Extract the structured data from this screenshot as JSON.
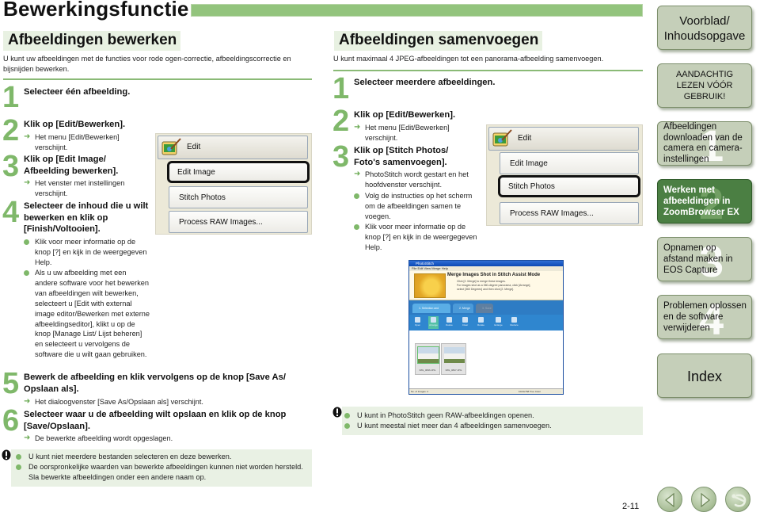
{
  "page": {
    "title": "Bewerkingsfunctie",
    "page_number": "2-11",
    "accent_color": "#93c47d",
    "step_number_color": "#7fb86a"
  },
  "left": {
    "heading": "Afbeeldingen bewerken",
    "intro": "U kunt uw afbeeldingen met de functies voor rode ogen-correctie, afbeeldingscorrectie en bijsnijden bewerken.",
    "steps": [
      {
        "num": "1",
        "title": "Selecteer één afbeelding."
      },
      {
        "num": "2",
        "title": "Klik op [Edit/Bewerken].",
        "subs": [
          "Het menu [Edit/Bewerken] verschijnt."
        ]
      },
      {
        "num": "3",
        "title": "Klik op [Edit Image/ Afbeelding bewerken].",
        "subs": [
          "Het venster met instellingen verschijnt."
        ]
      },
      {
        "num": "4",
        "title": "Selecteer de inhoud die u wilt bewerken en klik op [Finish/Voltooien].",
        "subs": [
          "Klik voor meer informatie op de knop [?] en kijk in de weergegeven Help.",
          "Als u uw afbeelding met een andere software voor het bewerken van afbeeldingen wilt bewerken, selecteert u [Edit with external image editor/Bewerken met externe afbeeldingseditor], klikt u op de knop [Manage List/ Lijst beheren] en selecteert u vervolgens de software die u wilt gaan gebruiken."
        ]
      },
      {
        "num": "5",
        "title": "Bewerk de afbeelding en klik vervolgens op de knop [Save As/ Opslaan als].",
        "subs": [
          "Het dialoogvenster [Save As/Opslaan als] verschijnt."
        ]
      },
      {
        "num": "6",
        "title": "Selecteer waar u de afbeelding wilt opslaan en klik op de knop [Save/Opslaan].",
        "subs": [
          "De bewerkte afbeelding wordt opgeslagen."
        ]
      }
    ],
    "menu": {
      "header": "Edit",
      "items": [
        "Edit Image",
        "Stitch Photos",
        "Process RAW Images..."
      ],
      "highlighted": "Edit Image"
    },
    "notes": [
      "U kunt niet meerdere bestanden selecteren en deze bewerken.",
      "De oorspronkelijke waarden van bewerkte afbeeldingen kunnen niet worden hersteld. Sla bewerkte afbeeldingen onder een andere naam op."
    ]
  },
  "right": {
    "heading": "Afbeeldingen samenvoegen",
    "intro": "U kunt maximaal 4 JPEG-afbeeldingen tot een panorama-afbeelding samenvoegen.",
    "steps": [
      {
        "num": "1",
        "title": "Selecteer meerdere afbeeldingen."
      },
      {
        "num": "2",
        "title": "Klik op [Edit/Bewerken].",
        "subs": [
          "Het menu [Edit/Bewerken] verschijnt."
        ]
      },
      {
        "num": "3",
        "title": "Klik op [Stitch Photos/ Foto's samenvoegen].",
        "subs": [
          "PhotoStitch wordt gestart en het hoofdvenster verschijnt.",
          "Volg de instructies op het scherm om de afbeeldingen samen te voegen.",
          "Klik voor meer informatie op de knop [?] en kijk in de weergegeven Help."
        ]
      }
    ],
    "menu": {
      "header": "Edit",
      "items": [
        "Edit Image",
        "Stitch Photos",
        "Process RAW Images..."
      ],
      "highlighted": "Stitch Photos"
    },
    "photostitch": {
      "window_title": "PhotoStitch",
      "menu": "File  Edit  View  Merge  Help",
      "banner_title": "Merge Images Shot in Stitch Assist Mode",
      "banner_lines": [
        "Click [2. Merge] to merge these images.",
        "For images shot as a 360-degree panorama, click [Arrange],",
        "select [360 Degrees] and then click [2. Merge]."
      ],
      "tabs": [
        "1. Selection and Arrangement",
        "2. Merge",
        "3. Save"
      ],
      "tools": [
        "Open",
        "Arrange",
        "Delete",
        "Clear",
        "Rotate",
        "Enlarge",
        "Reduce"
      ],
      "active_tool": "Arrange",
      "thumbnails": [
        "IMG_0846.JPG",
        "IMG_0847.JPG"
      ],
      "status_left": "No. of Images: 2",
      "status_right": "1024x768 True Color"
    },
    "notes": [
      "U kunt in PhotoStitch geen RAW-afbeeldingen openen.",
      "U kunt meestal niet meer dan 4 afbeeldingen samenvoegen."
    ]
  },
  "nav": {
    "items": [
      {
        "label": "Voorblad/ Inhoudsopgave",
        "chapter": ""
      },
      {
        "label": "AANDACHTIG LEZEN VÓÓR GEBRUIK!",
        "chapter": ""
      },
      {
        "label": "Afbeeldingen downloaden van de camera en camera-instellingen",
        "chapter": "1"
      },
      {
        "label": "Werken met afbeeldingen in ZoomBrowser EX",
        "chapter": "2",
        "active": true
      },
      {
        "label": "Opnamen op afstand maken in EOS Capture",
        "chapter": "3"
      },
      {
        "label": "Problemen oplossen en de software verwijderen",
        "chapter": "4"
      },
      {
        "label": "Index",
        "chapter": ""
      }
    ],
    "buttons": [
      "previous-page",
      "next-page",
      "back"
    ]
  }
}
